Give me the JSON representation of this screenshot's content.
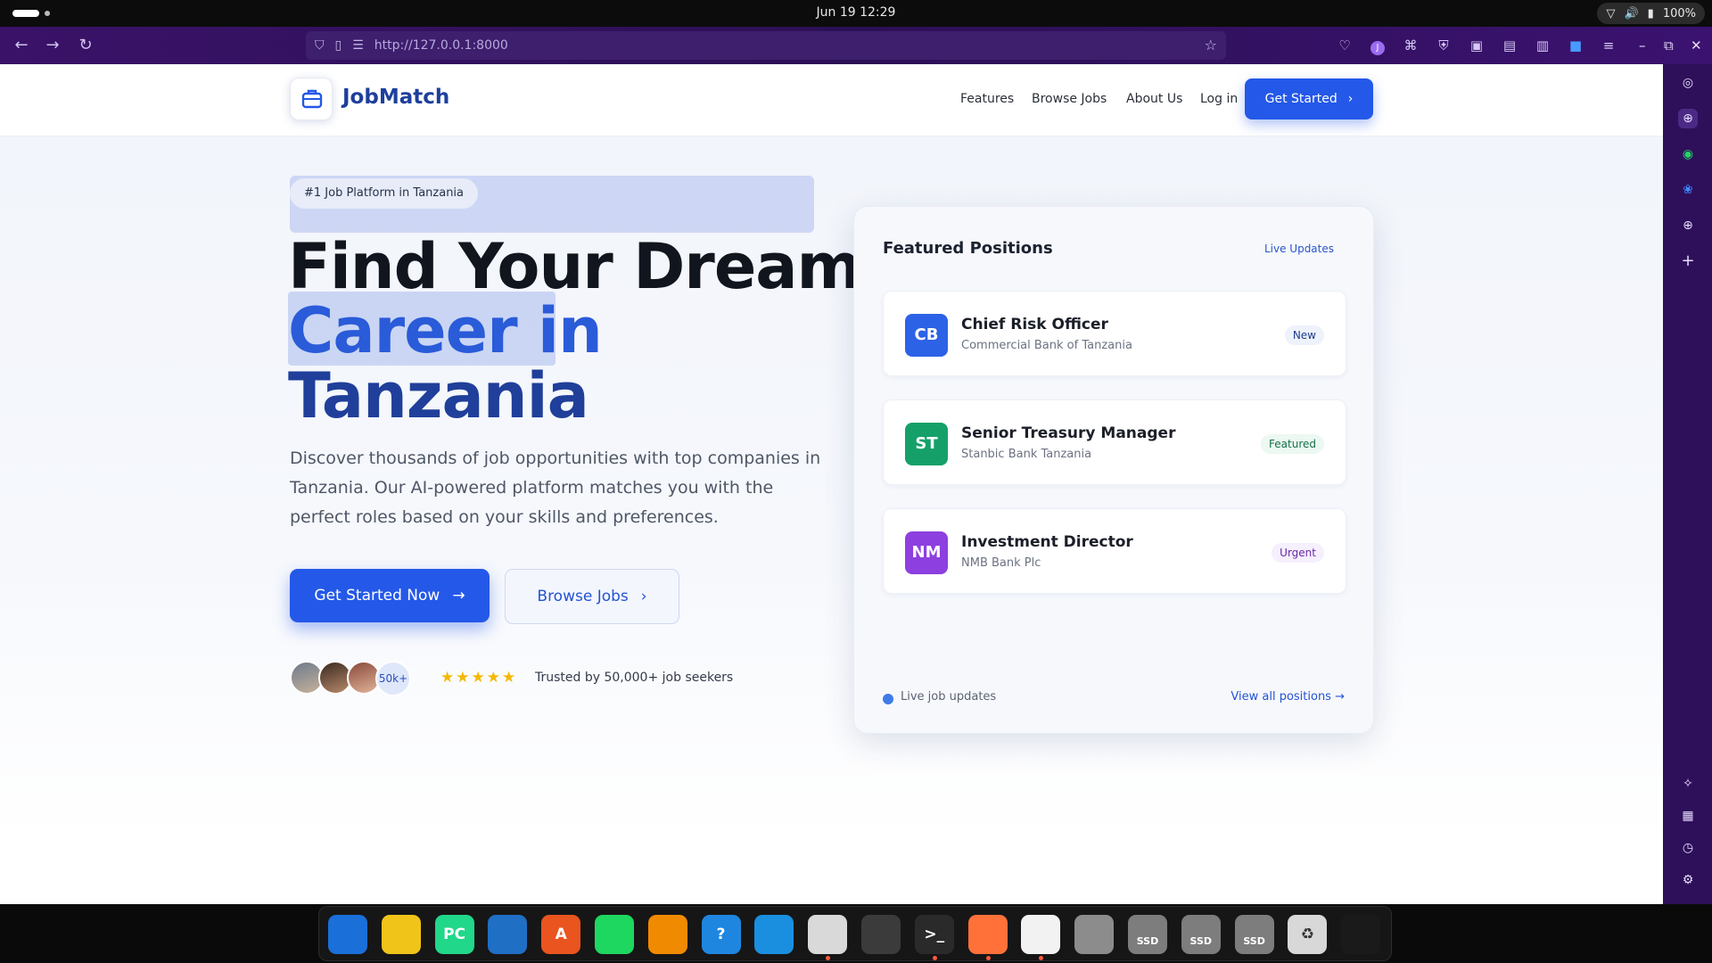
{
  "os": {
    "clock": "Jun 19  12:29",
    "battery": "100%",
    "icons": [
      "wifi-icon",
      "volume-icon",
      "battery-icon"
    ]
  },
  "browser": {
    "url": "http://127.0.0.1:8000",
    "nav_icons": [
      "back-icon",
      "forward-icon",
      "reload-icon"
    ],
    "extensions": [
      "pocket-icon",
      "profile-icon",
      "extensions-icon",
      "ublock-icon",
      "container-icon",
      "reader-icon",
      "sidebar-icon",
      "translate-icon",
      "menu-icon"
    ],
    "sidebar_icons": [
      "chatgpt-icon",
      "globe-icon",
      "whatsapp-icon",
      "bluesky-icon",
      "web-icon",
      "add-icon",
      "ai-sparkle-icon",
      "save-icon",
      "history-icon",
      "settings-icon"
    ]
  },
  "header": {
    "logo_text": "JobMatch",
    "nav": [
      "Features",
      "Browse Jobs",
      "About Us",
      "Log in"
    ],
    "cta": "Get Started"
  },
  "hero": {
    "badge": "#1 Job Platform in Tanzania",
    "line1": "Find Your Dream",
    "line2": "Career in",
    "line3": "Tanzania",
    "subtitle": "Discover thousands of job opportunities with top companies in Tanzania. Our AI-powered platform matches you with the perfect roles based on your skills and preferences.",
    "primary_button": "Get Started Now",
    "secondary_button": "Browse Jobs",
    "avatar_count": "50k+",
    "stars": "★★★★★",
    "rating": 5,
    "trust_text": "Trusted by 50,000+ job seekers"
  },
  "featured": {
    "title": "Featured Positions",
    "live_label": "Live Updates",
    "jobs": [
      {
        "initials": "CB",
        "title": "Chief Risk Officer",
        "company": "Commercial Bank of Tanzania",
        "tag": "New",
        "logo_color": "#2c62e6",
        "tag_bg": "#eef2fb",
        "tag_color": "#1e3c8c"
      },
      {
        "initials": "ST",
        "title": "Senior Treasury Manager",
        "company": "Stanbic Bank Tanzania",
        "tag": "Featured",
        "logo_color": "#15a06a",
        "tag_bg": "#ecf8f2",
        "tag_color": "#167048"
      },
      {
        "initials": "NM",
        "title": "Investment Director",
        "company": "NMB Bank Plc",
        "tag": "Urgent",
        "logo_color": "#8d3fe0",
        "tag_bg": "#f6effd",
        "tag_color": "#6a2aa8"
      }
    ],
    "footer_live": "Live job updates",
    "view_all": "View all positions →"
  },
  "dock": {
    "apps": [
      {
        "name": "thunderbird-icon",
        "label": "",
        "color": "#1a6fd8"
      },
      {
        "name": "rhythmbox-icon",
        "label": "",
        "color": "#f0c419"
      },
      {
        "name": "pycharm-icon",
        "label": "PC",
        "color": "#21d789"
      },
      {
        "name": "writer-icon",
        "label": "",
        "color": "#1f6fc5"
      },
      {
        "name": "app-center-icon",
        "label": "A",
        "color": "#e9541f"
      },
      {
        "name": "spotify-icon",
        "label": "",
        "color": "#1ed760"
      },
      {
        "name": "vlc-icon",
        "label": "",
        "color": "#f08a00"
      },
      {
        "name": "help-icon",
        "label": "?",
        "color": "#1f86e0"
      },
      {
        "name": "vscode-icon",
        "label": "",
        "color": "#1a8fe0"
      },
      {
        "name": "files-icon",
        "label": "",
        "color": "#d9d9d9"
      },
      {
        "name": "system-monitor-icon",
        "label": "",
        "color": "#3b3b3b"
      },
      {
        "name": "terminal-icon",
        "label": ">_",
        "color": "#2a2a2a"
      },
      {
        "name": "firefox-icon",
        "label": "",
        "color": "#ff7139"
      },
      {
        "name": "inkscape-icon",
        "label": "",
        "color": "#f2f2f2"
      },
      {
        "name": "disk-icon",
        "label": "",
        "color": "#8c8c8c"
      },
      {
        "name": "ssd-drive-icon-1",
        "label": "SSD",
        "color": "#7d7d7d"
      },
      {
        "name": "ssd-drive-icon-2",
        "label": "SSD",
        "color": "#7d7d7d"
      },
      {
        "name": "ssd-drive-icon-3",
        "label": "SSD",
        "color": "#7d7d7d"
      },
      {
        "name": "trash-icon",
        "label": "♻",
        "color": "#d8d8d8"
      },
      {
        "name": "ubuntu-icon",
        "label": "",
        "color": "#1a1a1a"
      }
    ]
  }
}
